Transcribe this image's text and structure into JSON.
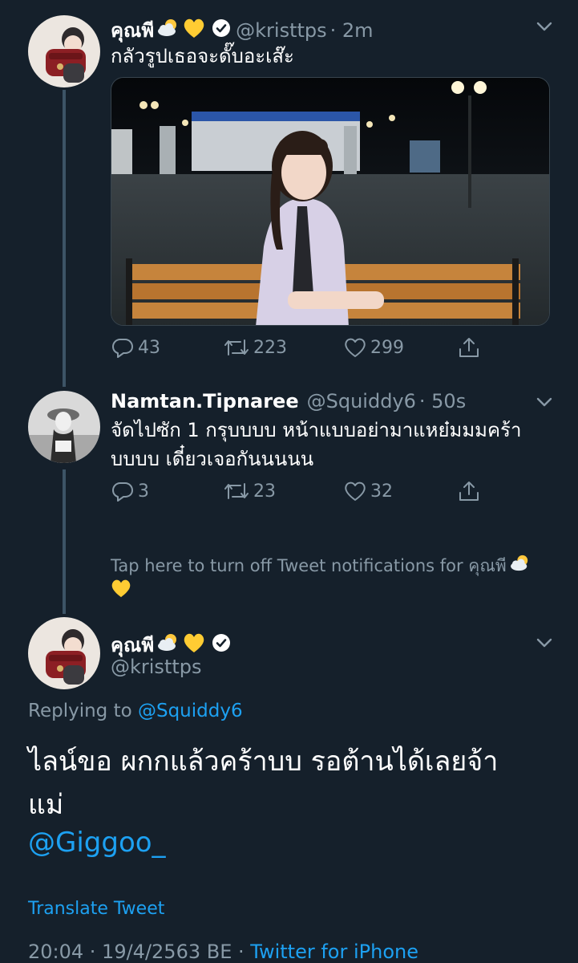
{
  "tweet1": {
    "display_name": "คุณพี",
    "handle": "@kristtps",
    "time": "· 2m",
    "text": "กลัวรูปเธอจะดั๊บอะเส๊ะ",
    "reply_count": "43",
    "retweet_count": "223",
    "like_count": "299"
  },
  "tweet2": {
    "display_name": "Namtan.Tipnaree",
    "handle": "@Squiddy6",
    "time": "· 50s",
    "text_line1": "จัดไปซัก 1 กรุบบบบ หน้าแบบอย่ามาแหย๋มมมคร้า",
    "text_line2": "บบบบ เดี๋ยวเจอกันนนนน",
    "reply_count": "3",
    "retweet_count": "23",
    "like_count": "32"
  },
  "notifications": {
    "text": "Tap here to turn off Tweet notifications for คุณพี"
  },
  "main_tweet": {
    "display_name": "คุณพี",
    "handle": "@kristtps",
    "replying_prefix": "Replying to",
    "replying_to": "@Squiddy6",
    "text_line1": "ไลน์ขอ ผกกแล้วคร้าบบ รอต้านได้เลยจ้า",
    "text_line2": "แม่",
    "mention": "@Giggoo_",
    "translate": "Translate Tweet",
    "timestamp": "20:04 · 19/4/2563 BE · ",
    "source": "Twitter for iPhone"
  },
  "icons": {
    "reply": "reply-icon",
    "retweet": "retweet-icon",
    "like": "heart-icon",
    "share": "share-icon",
    "verified": "verified-badge-icon",
    "caret": "chevron-down-icon",
    "sun_cloud": "sun-behind-cloud-emoji",
    "yellow_heart": "yellow-heart-emoji"
  },
  "colors": {
    "background": "#15202b",
    "link": "#1da1f2",
    "secondary_text": "#8899a6",
    "thread_line": "#3d5466"
  }
}
